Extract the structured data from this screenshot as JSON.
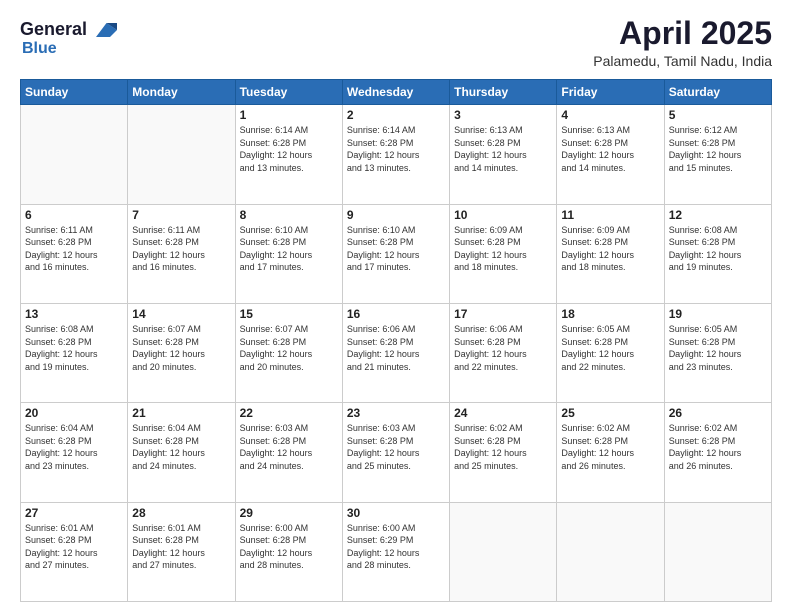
{
  "header": {
    "logo_line1": "General",
    "logo_line2": "Blue",
    "month": "April 2025",
    "location": "Palamedu, Tamil Nadu, India"
  },
  "weekdays": [
    "Sunday",
    "Monday",
    "Tuesday",
    "Wednesday",
    "Thursday",
    "Friday",
    "Saturday"
  ],
  "weeks": [
    [
      {
        "day": "",
        "info": ""
      },
      {
        "day": "",
        "info": ""
      },
      {
        "day": "1",
        "info": "Sunrise: 6:14 AM\nSunset: 6:28 PM\nDaylight: 12 hours\nand 13 minutes."
      },
      {
        "day": "2",
        "info": "Sunrise: 6:14 AM\nSunset: 6:28 PM\nDaylight: 12 hours\nand 13 minutes."
      },
      {
        "day": "3",
        "info": "Sunrise: 6:13 AM\nSunset: 6:28 PM\nDaylight: 12 hours\nand 14 minutes."
      },
      {
        "day": "4",
        "info": "Sunrise: 6:13 AM\nSunset: 6:28 PM\nDaylight: 12 hours\nand 14 minutes."
      },
      {
        "day": "5",
        "info": "Sunrise: 6:12 AM\nSunset: 6:28 PM\nDaylight: 12 hours\nand 15 minutes."
      }
    ],
    [
      {
        "day": "6",
        "info": "Sunrise: 6:11 AM\nSunset: 6:28 PM\nDaylight: 12 hours\nand 16 minutes."
      },
      {
        "day": "7",
        "info": "Sunrise: 6:11 AM\nSunset: 6:28 PM\nDaylight: 12 hours\nand 16 minutes."
      },
      {
        "day": "8",
        "info": "Sunrise: 6:10 AM\nSunset: 6:28 PM\nDaylight: 12 hours\nand 17 minutes."
      },
      {
        "day": "9",
        "info": "Sunrise: 6:10 AM\nSunset: 6:28 PM\nDaylight: 12 hours\nand 17 minutes."
      },
      {
        "day": "10",
        "info": "Sunrise: 6:09 AM\nSunset: 6:28 PM\nDaylight: 12 hours\nand 18 minutes."
      },
      {
        "day": "11",
        "info": "Sunrise: 6:09 AM\nSunset: 6:28 PM\nDaylight: 12 hours\nand 18 minutes."
      },
      {
        "day": "12",
        "info": "Sunrise: 6:08 AM\nSunset: 6:28 PM\nDaylight: 12 hours\nand 19 minutes."
      }
    ],
    [
      {
        "day": "13",
        "info": "Sunrise: 6:08 AM\nSunset: 6:28 PM\nDaylight: 12 hours\nand 19 minutes."
      },
      {
        "day": "14",
        "info": "Sunrise: 6:07 AM\nSunset: 6:28 PM\nDaylight: 12 hours\nand 20 minutes."
      },
      {
        "day": "15",
        "info": "Sunrise: 6:07 AM\nSunset: 6:28 PM\nDaylight: 12 hours\nand 20 minutes."
      },
      {
        "day": "16",
        "info": "Sunrise: 6:06 AM\nSunset: 6:28 PM\nDaylight: 12 hours\nand 21 minutes."
      },
      {
        "day": "17",
        "info": "Sunrise: 6:06 AM\nSunset: 6:28 PM\nDaylight: 12 hours\nand 22 minutes."
      },
      {
        "day": "18",
        "info": "Sunrise: 6:05 AM\nSunset: 6:28 PM\nDaylight: 12 hours\nand 22 minutes."
      },
      {
        "day": "19",
        "info": "Sunrise: 6:05 AM\nSunset: 6:28 PM\nDaylight: 12 hours\nand 23 minutes."
      }
    ],
    [
      {
        "day": "20",
        "info": "Sunrise: 6:04 AM\nSunset: 6:28 PM\nDaylight: 12 hours\nand 23 minutes."
      },
      {
        "day": "21",
        "info": "Sunrise: 6:04 AM\nSunset: 6:28 PM\nDaylight: 12 hours\nand 24 minutes."
      },
      {
        "day": "22",
        "info": "Sunrise: 6:03 AM\nSunset: 6:28 PM\nDaylight: 12 hours\nand 24 minutes."
      },
      {
        "day": "23",
        "info": "Sunrise: 6:03 AM\nSunset: 6:28 PM\nDaylight: 12 hours\nand 25 minutes."
      },
      {
        "day": "24",
        "info": "Sunrise: 6:02 AM\nSunset: 6:28 PM\nDaylight: 12 hours\nand 25 minutes."
      },
      {
        "day": "25",
        "info": "Sunrise: 6:02 AM\nSunset: 6:28 PM\nDaylight: 12 hours\nand 26 minutes."
      },
      {
        "day": "26",
        "info": "Sunrise: 6:02 AM\nSunset: 6:28 PM\nDaylight: 12 hours\nand 26 minutes."
      }
    ],
    [
      {
        "day": "27",
        "info": "Sunrise: 6:01 AM\nSunset: 6:28 PM\nDaylight: 12 hours\nand 27 minutes."
      },
      {
        "day": "28",
        "info": "Sunrise: 6:01 AM\nSunset: 6:28 PM\nDaylight: 12 hours\nand 27 minutes."
      },
      {
        "day": "29",
        "info": "Sunrise: 6:00 AM\nSunset: 6:28 PM\nDaylight: 12 hours\nand 28 minutes."
      },
      {
        "day": "30",
        "info": "Sunrise: 6:00 AM\nSunset: 6:29 PM\nDaylight: 12 hours\nand 28 minutes."
      },
      {
        "day": "",
        "info": ""
      },
      {
        "day": "",
        "info": ""
      },
      {
        "day": "",
        "info": ""
      }
    ]
  ]
}
